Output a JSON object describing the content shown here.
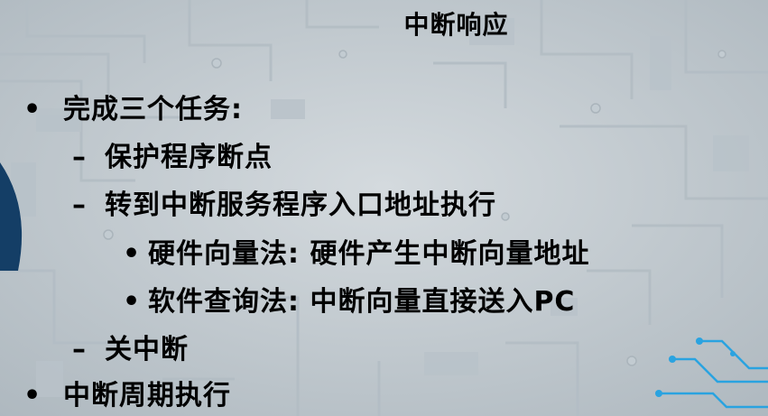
{
  "slide": {
    "title": "中断响应",
    "bullets": [
      {
        "marker": "•",
        "text": "完成三个任务:"
      },
      {
        "marker": "–",
        "text": "保护程序断点"
      },
      {
        "marker": "–",
        "text": "转到中断服务程序入口地址执行"
      },
      {
        "marker": "•",
        "text": "硬件向量法: 硬件产生中断向量地址"
      },
      {
        "marker": "•",
        "text": "软件查询法: 中断向量直接送入PC"
      },
      {
        "marker": "–",
        "text": "关中断"
      },
      {
        "marker": "•",
        "text": "中断周期执行"
      }
    ]
  },
  "colors": {
    "background": "#c9d1d6",
    "circuit_traces": "#b4bec5",
    "accent_blue": "#2aa3e0",
    "text": "#000000"
  }
}
